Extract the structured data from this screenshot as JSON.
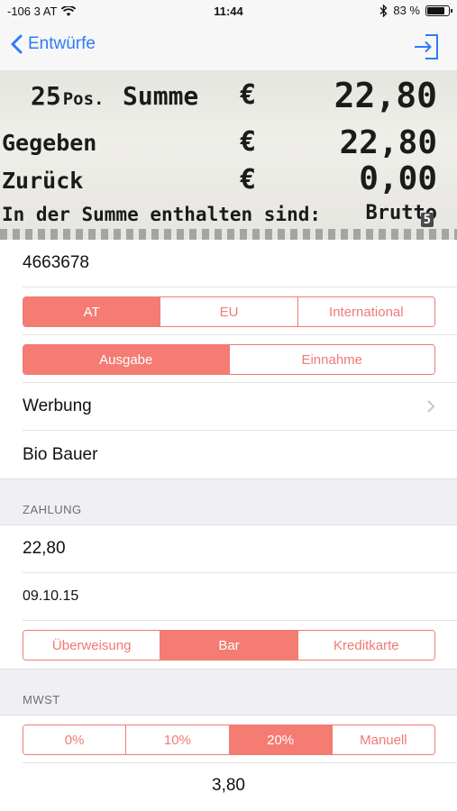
{
  "status_bar": {
    "carrier": "-106 3 AT",
    "time": "11:44",
    "battery_percent": "83 %",
    "battery_level": 0.83
  },
  "nav": {
    "back_label": "Entwürfe",
    "export_icon": "export-icon"
  },
  "receipt": {
    "line1_count": "25",
    "line1_pos": "Pos.",
    "line1_label": "Summe",
    "line1_currency": "€",
    "line1_amount": "22,80",
    "line2_label": "Gegeben",
    "line2_currency": "€",
    "line2_amount": "22,80",
    "line3_label": "Zurück",
    "line3_currency": "€",
    "line3_amount": "0,00",
    "line4_text": "In der Summe enthalten sind:",
    "line4_right": "Brutto",
    "page_marker": "5"
  },
  "form": {
    "receipt_number": "4663678",
    "region_options": [
      "AT",
      "EU",
      "International"
    ],
    "region_selected": "AT",
    "type_options": [
      "Ausgabe",
      "Einnahme"
    ],
    "type_selected": "Ausgabe",
    "category": "Werbung",
    "vendor": "Bio Bauer",
    "payment_header": "ZAHLUNG",
    "amount": "22,80",
    "date": "09.10.15",
    "payment_options": [
      "Überweisung",
      "Bar",
      "Kreditkarte"
    ],
    "payment_selected": "Bar",
    "vat_header": "MWST",
    "vat_options": [
      "0%",
      "10%",
      "20%",
      "Manuell"
    ],
    "vat_selected": "20%",
    "vat_amount": "3,80"
  },
  "colors": {
    "accent": "#f47c73",
    "link": "#2f7bf5",
    "section_bg": "#efeff4"
  }
}
